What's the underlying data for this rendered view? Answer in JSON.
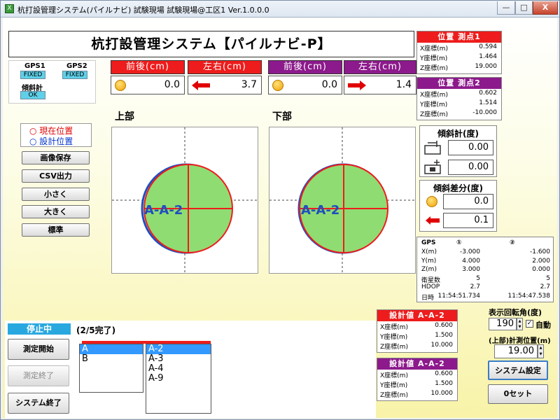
{
  "window": {
    "title": "杭打設管理システム(パイルナビ) 試験現場 試験現場@工区1  Ver.1.0.0.0",
    "icon": "X",
    "min": "—",
    "max": "□",
    "close": "X"
  },
  "app_title": "杭打設管理システム【パイルナビ-P】",
  "gps": {
    "gps1_label": "GPS1",
    "gps1_status": "FIXED",
    "gps2_label": "GPS2",
    "gps2_status": "FIXED",
    "tilt_label": "傾斜計",
    "tilt_status": "OK"
  },
  "top": {
    "front_label": "前後(cm)",
    "lr_label": "左右(cm)",
    "upper_front": "0.0",
    "upper_lr": "3.7",
    "lower_front": "0.0",
    "lower_lr": "1.4"
  },
  "legend": {
    "current": "現在位置",
    "design": "設計位置"
  },
  "buttons": {
    "save_image": "画像保存",
    "csv": "CSV出力",
    "smaller": "小さく",
    "larger": "大きく",
    "standard": "標準",
    "start": "測定開始",
    "end": "測定終了",
    "exit": "システム終了",
    "system_settings": "システム設定",
    "zero_set": "0セット"
  },
  "plots": {
    "upper": "上部",
    "lower": "下部",
    "label": "A-A-2"
  },
  "pos1": {
    "title": "位置 測点1",
    "x_label": "X座標(m)",
    "y_label": "Y座標(m)",
    "z_label": "Z座標(m)",
    "x": "0.594",
    "y": "1.464",
    "z": "19.000"
  },
  "pos2": {
    "title": "位置 測点2",
    "x_label": "X座標(m)",
    "y_label": "Y座標(m)",
    "z_label": "Z座標(m)",
    "x": "0.602",
    "y": "1.514",
    "z": "-10.000"
  },
  "tilt": {
    "title": "傾斜計(度)",
    "v1": "0.00",
    "v2": "0.00"
  },
  "tilt_diff": {
    "title": "傾斜差分(度)",
    "v1": "0.0",
    "v2": "0.1"
  },
  "gps_info": {
    "header": "GPS",
    "c1": "①",
    "c2": "②",
    "rows": [
      {
        "k": "X(m)",
        "a": "-3.000",
        "b": "-1.600"
      },
      {
        "k": "Y(m)",
        "a": "4.000",
        "b": "2.000"
      },
      {
        "k": "Z(m)",
        "a": "3.000",
        "b": "0.000"
      },
      {
        "k": "衛星数",
        "a": "5",
        "b": "5"
      },
      {
        "k": "HDOP",
        "a": "2.7",
        "b": "2.7"
      },
      {
        "k": "日時",
        "a": "11:54:51.734",
        "b": "11:54:47.538"
      }
    ]
  },
  "bottom": {
    "status": "停止中",
    "progress": "(2/5完了)",
    "list1": [
      "A",
      "B"
    ],
    "list2": [
      "A-2",
      "A-3",
      "A-4",
      "A-9"
    ]
  },
  "design1": {
    "title": "設計値 A-A-2",
    "x_label": "X座標(m)",
    "y_label": "Y座標(m)",
    "z_label": "Z座標(m)",
    "x": "0.600",
    "y": "1.500",
    "z": "10.000"
  },
  "design2": {
    "title": "設計値 A-A-2",
    "x_label": "X座標(m)",
    "y_label": "Y座標(m)",
    "z_label": "Z座標(m)",
    "x": "0.600",
    "y": "1.500",
    "z": "10.000"
  },
  "display": {
    "rotation_label": "表示回転角(度)",
    "rotation": "190",
    "auto": "自動",
    "measure_label": "(上部)計測位置(m)",
    "measure": "19.00"
  },
  "colors": {
    "red": "#ee1c1c",
    "purple": "#8c1a8c",
    "green": "#8fdc72"
  }
}
